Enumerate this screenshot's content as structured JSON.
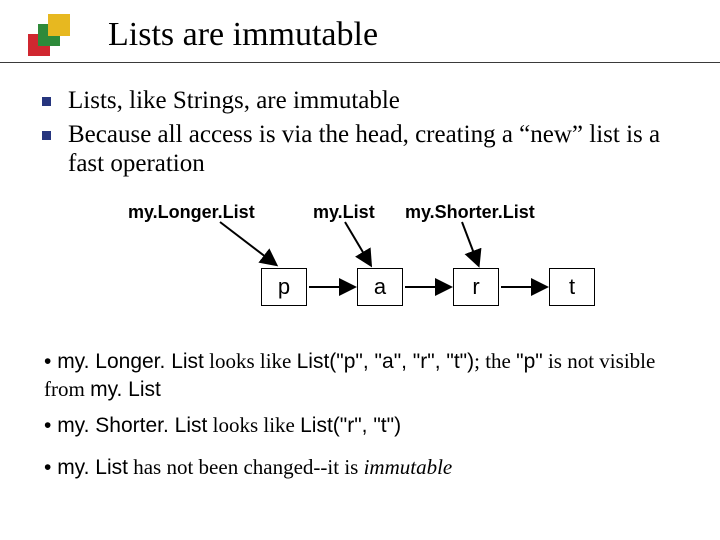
{
  "title": "Lists are immutable",
  "bullets": [
    "Lists, like Strings, are immutable",
    "Because all access is via the head, creating a “new” list is a fast operation"
  ],
  "diagram": {
    "labels": {
      "longer": "my.Longer.List",
      "mid": "my.List",
      "shorter": "my.Shorter.List"
    },
    "nodes": [
      "p",
      "a",
      "r",
      "t"
    ]
  },
  "notes": {
    "n1_pre": "• ",
    "n1_a": "my. Longer. List",
    "n1_b": " looks like ",
    "n1_c": "List(\"p\", \"a\", \"r\", \"t\")",
    "n1_d": "; the ",
    "n1_e": "\"p\"",
    "n1_f": " is not visible from ",
    "n1_g": "my. List",
    "n2_pre": "• ",
    "n2_a": "my. Shorter. List",
    "n2_b": " looks like ",
    "n2_c": "List(\"r\", \"t\")",
    "n3_pre": "• ",
    "n3_a": "my. List",
    "n3_b": " has not been changed--it is ",
    "n3_c": "immutable"
  },
  "chart_data": {
    "type": "table",
    "title": "Linked-list diagram",
    "pointers": [
      {
        "label": "my.Longer.List",
        "points_to_index": 0
      },
      {
        "label": "my.List",
        "points_to_index": 1
      },
      {
        "label": "my.Shorter.List",
        "points_to_index": 2
      }
    ],
    "nodes": [
      "p",
      "a",
      "r",
      "t"
    ],
    "edges": [
      [
        0,
        1
      ],
      [
        1,
        2
      ],
      [
        2,
        3
      ]
    ]
  }
}
